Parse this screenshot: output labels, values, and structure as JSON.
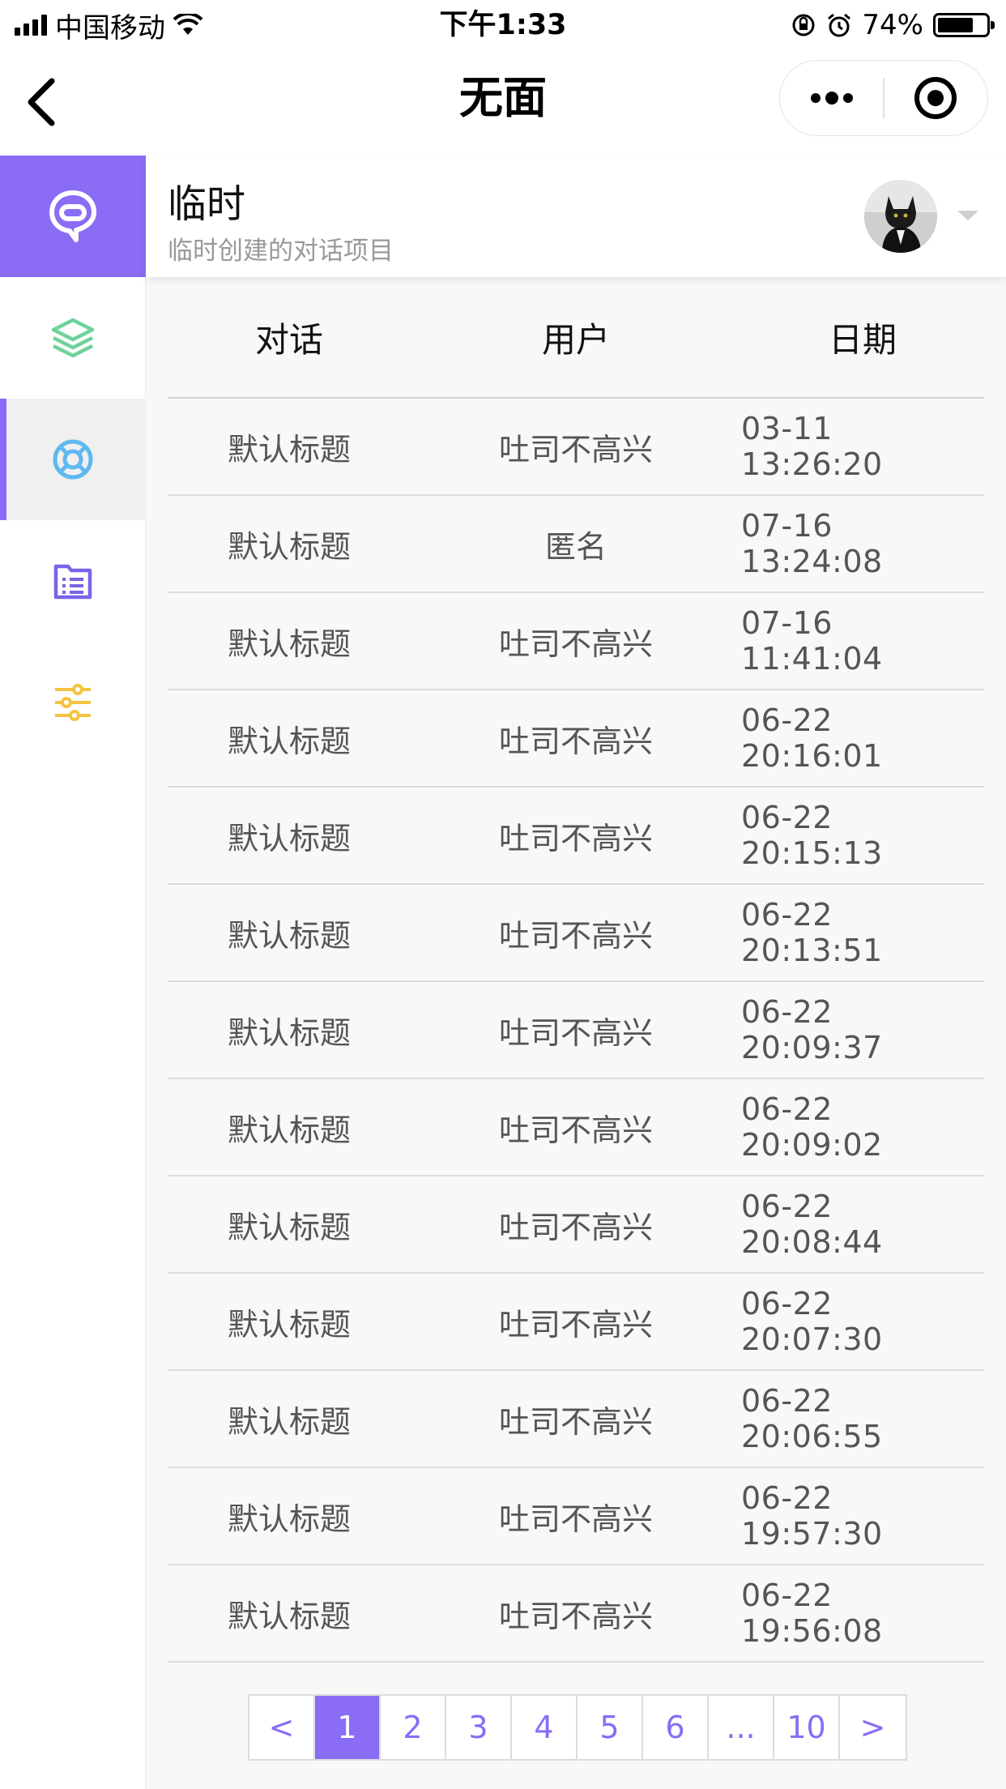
{
  "status_bar": {
    "carrier": "中国移动",
    "time": "下午1:33",
    "battery": "74%",
    "battery_level": 0.74
  },
  "nav": {
    "title": "无面"
  },
  "project": {
    "name": "临时",
    "description": "临时创建的对话项目"
  },
  "sidebar": {
    "items": [
      {
        "icon": "chat-bubble-icon",
        "color": "#ffffff"
      },
      {
        "icon": "layers-icon",
        "color": "#6dd39a"
      },
      {
        "icon": "lifebuoy-icon",
        "color": "#5fb8f0"
      },
      {
        "icon": "document-list-icon",
        "color": "#7b63e6"
      },
      {
        "icon": "sliders-icon",
        "color": "#f5c242"
      }
    ],
    "active_index": 2
  },
  "table": {
    "headers": [
      "对话",
      "用户",
      "日期"
    ],
    "rows": [
      {
        "title": "默认标题",
        "user": "吐司不高兴",
        "date": "03-11 13:26:20"
      },
      {
        "title": "默认标题",
        "user": "匿名",
        "date": "07-16 13:24:08"
      },
      {
        "title": "默认标题",
        "user": "吐司不高兴",
        "date": "07-16 11:41:04"
      },
      {
        "title": "默认标题",
        "user": "吐司不高兴",
        "date": "06-22 20:16:01"
      },
      {
        "title": "默认标题",
        "user": "吐司不高兴",
        "date": "06-22 20:15:13"
      },
      {
        "title": "默认标题",
        "user": "吐司不高兴",
        "date": "06-22 20:13:51"
      },
      {
        "title": "默认标题",
        "user": "吐司不高兴",
        "date": "06-22 20:09:37"
      },
      {
        "title": "默认标题",
        "user": "吐司不高兴",
        "date": "06-22 20:09:02"
      },
      {
        "title": "默认标题",
        "user": "吐司不高兴",
        "date": "06-22 20:08:44"
      },
      {
        "title": "默认标题",
        "user": "吐司不高兴",
        "date": "06-22 20:07:30"
      },
      {
        "title": "默认标题",
        "user": "吐司不高兴",
        "date": "06-22 20:06:55"
      },
      {
        "title": "默认标题",
        "user": "吐司不高兴",
        "date": "06-22 19:57:30"
      },
      {
        "title": "默认标题",
        "user": "吐司不高兴",
        "date": "06-22 19:56:08"
      }
    ]
  },
  "pagination": {
    "prev": "<",
    "pages": [
      "1",
      "2",
      "3",
      "4",
      "5",
      "6",
      "...",
      "10"
    ],
    "next": ">",
    "current": "1"
  },
  "colors": {
    "accent": "#8a6cf5"
  }
}
